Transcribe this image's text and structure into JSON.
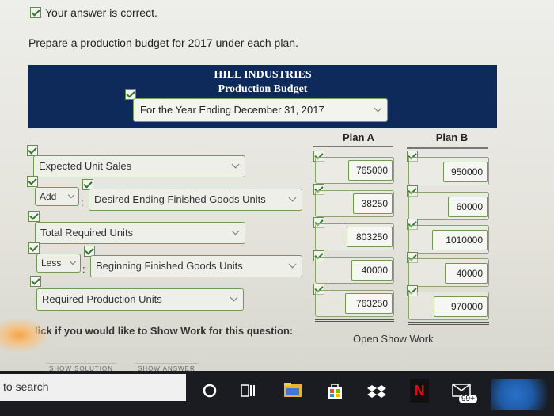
{
  "status": {
    "correct_text": "Your answer is correct."
  },
  "instruction": "Prepare a production budget for 2017 under each plan.",
  "header": {
    "company": "HILL INDUSTRIES",
    "statement": "Production Budget",
    "period": "For the Year Ending December 31, 2017"
  },
  "columns": {
    "plan_a": "Plan A",
    "plan_b": "Plan B"
  },
  "rows": [
    {
      "label": "Expected Unit Sales",
      "plan_a": "765000",
      "plan_b": "950000"
    },
    {
      "operator": "Add",
      "label": "Desired Ending Finished Goods Units",
      "plan_a": "38250",
      "plan_b": "60000"
    },
    {
      "label": "Total Required Units",
      "plan_a": "803250",
      "plan_b": "1010000"
    },
    {
      "operator": "Less",
      "label": "Beginning Finished Goods Units",
      "plan_a": "40000",
      "plan_b": "40000"
    },
    {
      "label": "Required Production Units",
      "plan_a": "763250",
      "plan_b": "970000"
    }
  ],
  "show_work": {
    "prompt": "lick if you would like to Show Work for this question:",
    "link": "Open Show Work"
  },
  "buttons": {
    "show_solution": "SHOW SOLUTION",
    "show_answer": "SHOW ANSWER"
  },
  "taskbar": {
    "search_text": "to search",
    "badge": "99+",
    "netflix": "N"
  },
  "colors": {
    "header_bg": "#0e2a5a",
    "accent_green": "#6f9a50"
  }
}
